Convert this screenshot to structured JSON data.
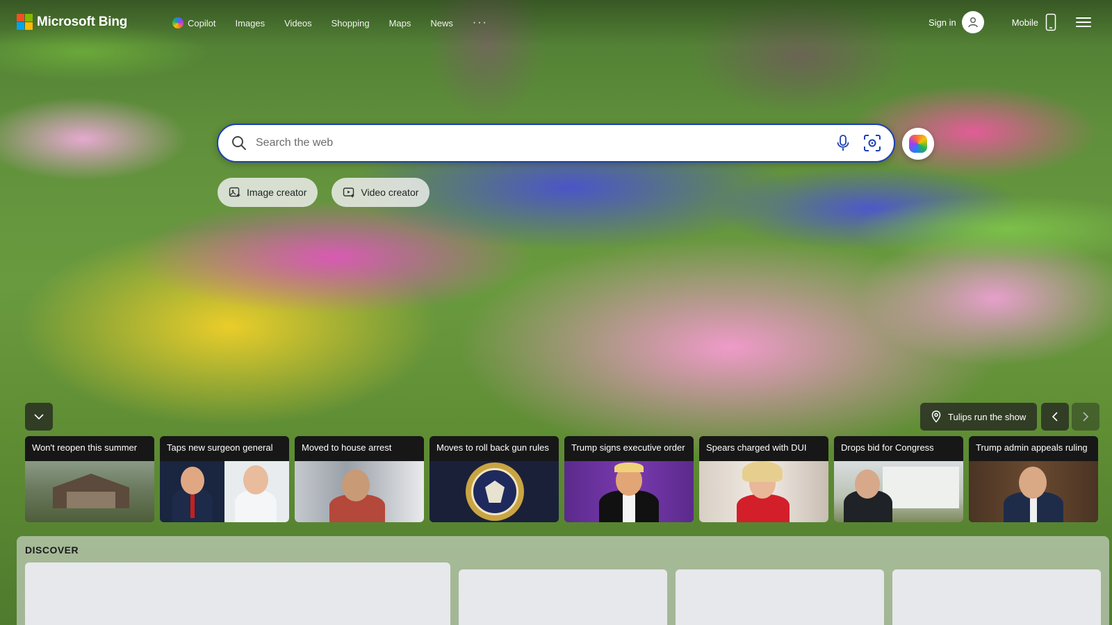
{
  "brand": {
    "name": "Microsoft Bing"
  },
  "nav": {
    "items": [
      "Copilot",
      "Images",
      "Videos",
      "Shopping",
      "Maps",
      "News"
    ],
    "more_label": "···"
  },
  "header": {
    "signin_label": "Sign in",
    "mobile_label": "Mobile"
  },
  "search": {
    "placeholder": "Search the web",
    "value": ""
  },
  "creators": [
    {
      "label": "Image creator",
      "icon": "image-creator-icon"
    },
    {
      "label": "Video creator",
      "icon": "video-creator-icon"
    }
  ],
  "background": {
    "location_label": "Tulips run the show"
  },
  "news": [
    {
      "title": "Won't reopen this summer"
    },
    {
      "title": "Taps new surgeon general"
    },
    {
      "title": "Moved to house arrest"
    },
    {
      "title": "Moves to roll back gun rules"
    },
    {
      "title": "Trump signs executive order"
    },
    {
      "title": "Spears charged with DUI"
    },
    {
      "title": "Drops bid for Congress"
    },
    {
      "title": "Trump admin appeals ruling"
    }
  ],
  "discover": {
    "title": "DISCOVER"
  },
  "colors": {
    "search_border": "#1a3fb5",
    "ms_red": "#f25022",
    "ms_green": "#7fba00",
    "ms_blue": "#00a4ef",
    "ms_yellow": "#ffb900"
  }
}
